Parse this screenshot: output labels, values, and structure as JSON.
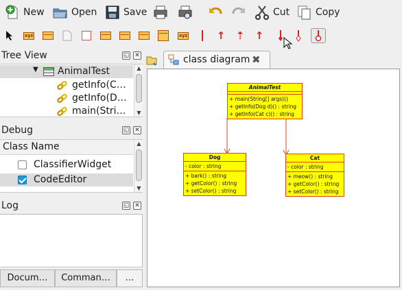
{
  "toolbar": {
    "new_label": "New",
    "open_label": "Open",
    "save_label": "Save",
    "cut_label": "Cut",
    "copy_label": "Copy"
  },
  "widget_toolbar": {
    "tools": [
      "select-arrow-icon",
      "class-xyz-icon",
      "class-swap-icon",
      "note-icon",
      "box-icon",
      "interface-icon",
      "datatype-icon",
      "enum-icon",
      "entity-icon",
      "package-xyz-icon",
      "association-line-icon",
      "generalization-arrow-icon",
      "realization-arrow-icon",
      "dependency-arrow-icon",
      "aggregation-arrow-icon",
      "composition-icon"
    ]
  },
  "tree_view": {
    "title": "Tree View",
    "items": [
      {
        "label": "AnimalTest",
        "kind": "class",
        "selected": true
      },
      {
        "label": "getInfo(C…",
        "kind": "operation"
      },
      {
        "label": "getInfo(D…",
        "kind": "operation"
      },
      {
        "label": "main(Stri…",
        "kind": "operation"
      }
    ]
  },
  "debug": {
    "title": "Debug",
    "column_header": "Class Name",
    "items": [
      {
        "label": "ClassifierWidget",
        "checked": false
      },
      {
        "label": "CodeEditor",
        "checked": true
      }
    ]
  },
  "log": {
    "title": "Log"
  },
  "bottom_tabs": [
    "Docum…",
    "Comman…",
    "…"
  ],
  "diagram_tab": {
    "label": "class diagram"
  },
  "diagram": {
    "classes": [
      {
        "name": "AnimalTest",
        "italic": true,
        "attributes": [],
        "operations": [
          "+ main(String[] args)()",
          "+ getInfo(Dog d)() : string",
          "+ getInfo(Cat c)() : string"
        ]
      },
      {
        "name": "Dog",
        "italic": false,
        "attributes": [
          "- color : string"
        ],
        "operations": [
          "+ bark() : string",
          "+ getColor() : string",
          "+ setColor() : string"
        ]
      },
      {
        "name": "Cat",
        "italic": false,
        "attributes": [
          "- color : string"
        ],
        "operations": [
          "+ meow() : string",
          "+ getColor() : string",
          "+ setColor() : string"
        ]
      }
    ]
  },
  "colors": {
    "class_fill": "#ffff00",
    "class_border": "#e2401d",
    "selection": "#dcdcdc",
    "check_blue": "#1a9ad6"
  }
}
